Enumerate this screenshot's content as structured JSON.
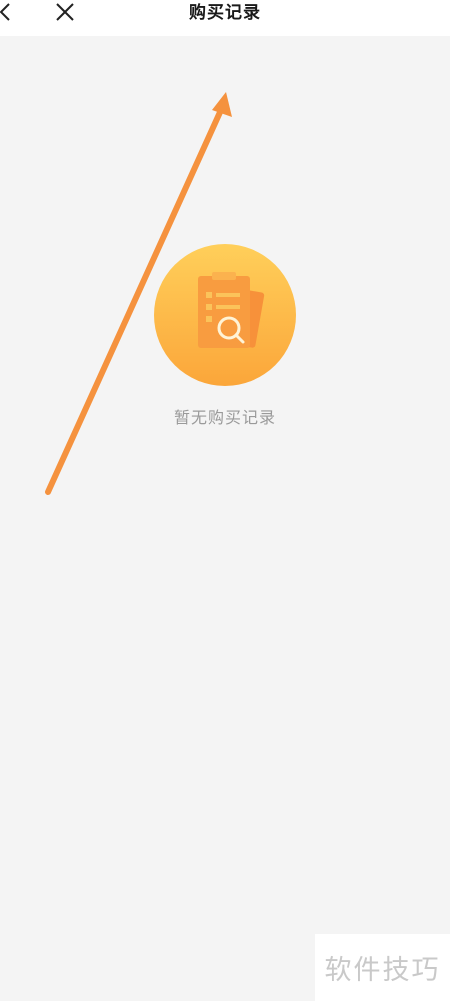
{
  "nav": {
    "title": "购买记录",
    "back_icon": "chevron-left-icon",
    "close_icon": "close-icon"
  },
  "empty_state": {
    "icon": "empty-receipt-search-icon",
    "message": "暂无购买记录"
  },
  "watermark": {
    "text": "软件技巧"
  },
  "colors": {
    "nav_background": "#ffffff",
    "page_background": "#f4f4f4",
    "accent_orange": "#f5923e",
    "illustration_gradient_top": "#ffcf5a",
    "illustration_gradient_bottom": "#fba63a",
    "empty_text": "#9a9a9a"
  }
}
